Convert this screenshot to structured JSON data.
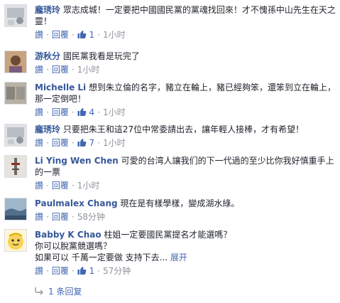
{
  "like_label": "讚",
  "reply_label": "回覆",
  "separator": "·",
  "colors": {
    "name": "#365899",
    "link": "#4267b2",
    "meta": "#90949c",
    "text": "#1d2129"
  },
  "comments": [
    {
      "name": "龐琇玲",
      "text": "眾志成城！一定要把中國國民黨的黨魂找回來！才不愧孫中山先生在天之靈！",
      "likes": "1",
      "time": "1小时"
    },
    {
      "name": "游秋分",
      "text": "國民黨我看是玩完了",
      "likes": "",
      "time": "1小时"
    },
    {
      "name": "Michelle Li",
      "text": "想到朱立倫的名字，豬立在輪上，豬已經夠笨，還笨到立在輪上，那一定倒吧！",
      "likes": "4",
      "time": "1小时"
    },
    {
      "name": "龐琇玲",
      "text": "只要把朱王和這27位中常委請出去，讓年輕人接棒，才有希望！",
      "likes": "7",
      "time": "1小时"
    },
    {
      "name": "Li Ying Wen Chen",
      "text": "可愛的台湾人讓我们的下一代過的至少比你我好慎重手上的一票",
      "likes": "",
      "time": "1小时"
    },
    {
      "name": "Paulmalex Chang",
      "text": "現在是有樣學樣，變成湖水綠。",
      "likes": "",
      "time": "58分钟"
    },
    {
      "name": "Babby K Chao",
      "text_lines": [
        "柱姐一定要國民黨提名才能選嗎？",
        "你可以脫黨競選嗎？",
        "如果可以 千萬一定要做 支持下去..."
      ],
      "more": "展开",
      "likes": "1",
      "time": "57分钟"
    }
  ],
  "replies": {
    "label": "1 条回复",
    "icon": "reply-arrow-icon"
  }
}
